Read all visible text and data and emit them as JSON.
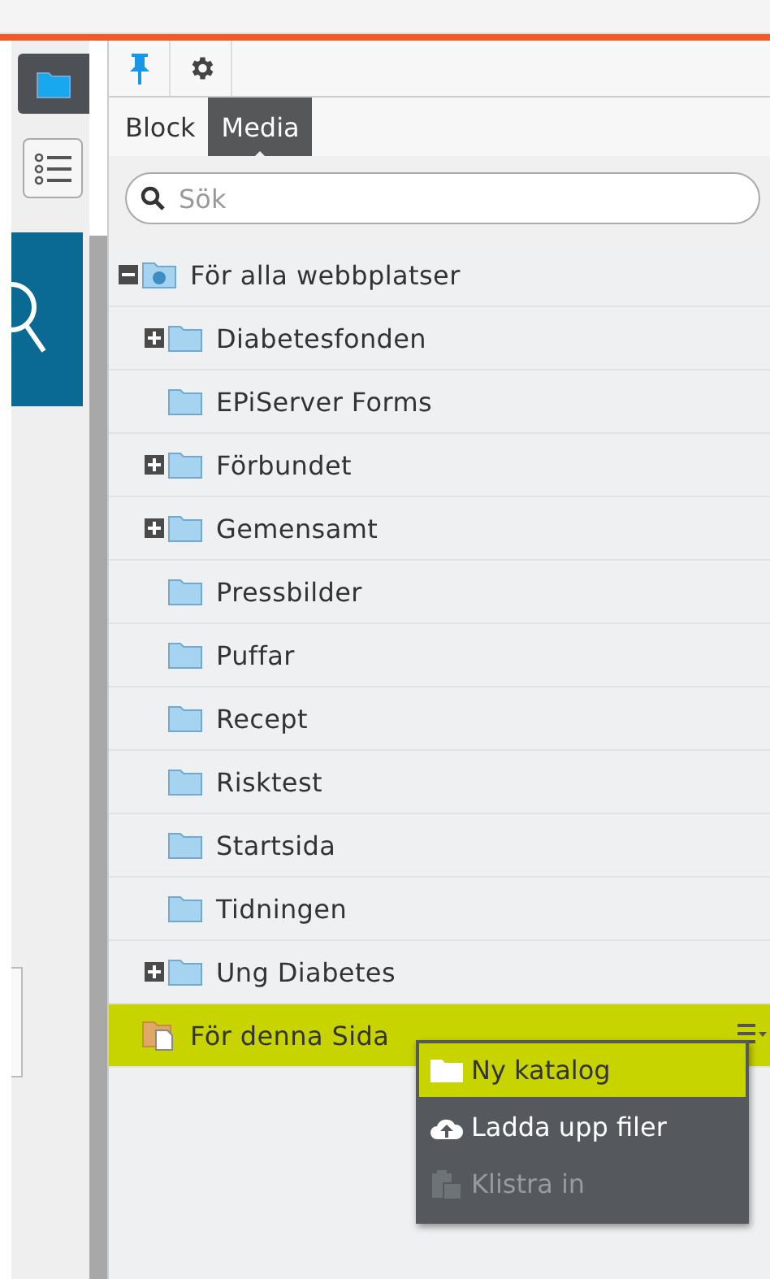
{
  "toolbar": {
    "pinned": true
  },
  "tabs": [
    {
      "label": "Block",
      "selected": false
    },
    {
      "label": "Media",
      "selected": true
    }
  ],
  "search": {
    "placeholder": "Sök"
  },
  "tree": [
    {
      "label": "För alla webbplatser",
      "kind": "site",
      "expanded": true,
      "selected": false,
      "children": [
        {
          "label": "Diabetesfonden",
          "kind": "folder",
          "has_children": true,
          "selected": false
        },
        {
          "label": "EPiServer Forms",
          "kind": "folder",
          "has_children": false,
          "selected": false
        },
        {
          "label": "Förbundet",
          "kind": "folder",
          "has_children": true,
          "selected": false
        },
        {
          "label": "Gemensamt",
          "kind": "folder",
          "has_children": true,
          "selected": false
        },
        {
          "label": "Pressbilder",
          "kind": "folder",
          "has_children": false,
          "selected": false
        },
        {
          "label": "Puffar",
          "kind": "folder",
          "has_children": false,
          "selected": false
        },
        {
          "label": "Recept",
          "kind": "folder",
          "has_children": false,
          "selected": false
        },
        {
          "label": "Risktest",
          "kind": "folder",
          "has_children": false,
          "selected": false
        },
        {
          "label": "Startsida",
          "kind": "folder",
          "has_children": false,
          "selected": false
        },
        {
          "label": "Tidningen",
          "kind": "folder",
          "has_children": false,
          "selected": false
        },
        {
          "label": "Ung Diabetes",
          "kind": "folder",
          "has_children": true,
          "selected": false
        }
      ]
    },
    {
      "label": "För denna Sida",
      "kind": "page",
      "selected": true
    }
  ],
  "context_menu": [
    {
      "label": "Ny katalog",
      "kind": "folder",
      "selected": true,
      "disabled": false
    },
    {
      "label": "Ladda upp filer",
      "kind": "upload",
      "selected": false,
      "disabled": false
    },
    {
      "label": "Klistra in",
      "kind": "paste",
      "selected": false,
      "disabled": true
    }
  ]
}
